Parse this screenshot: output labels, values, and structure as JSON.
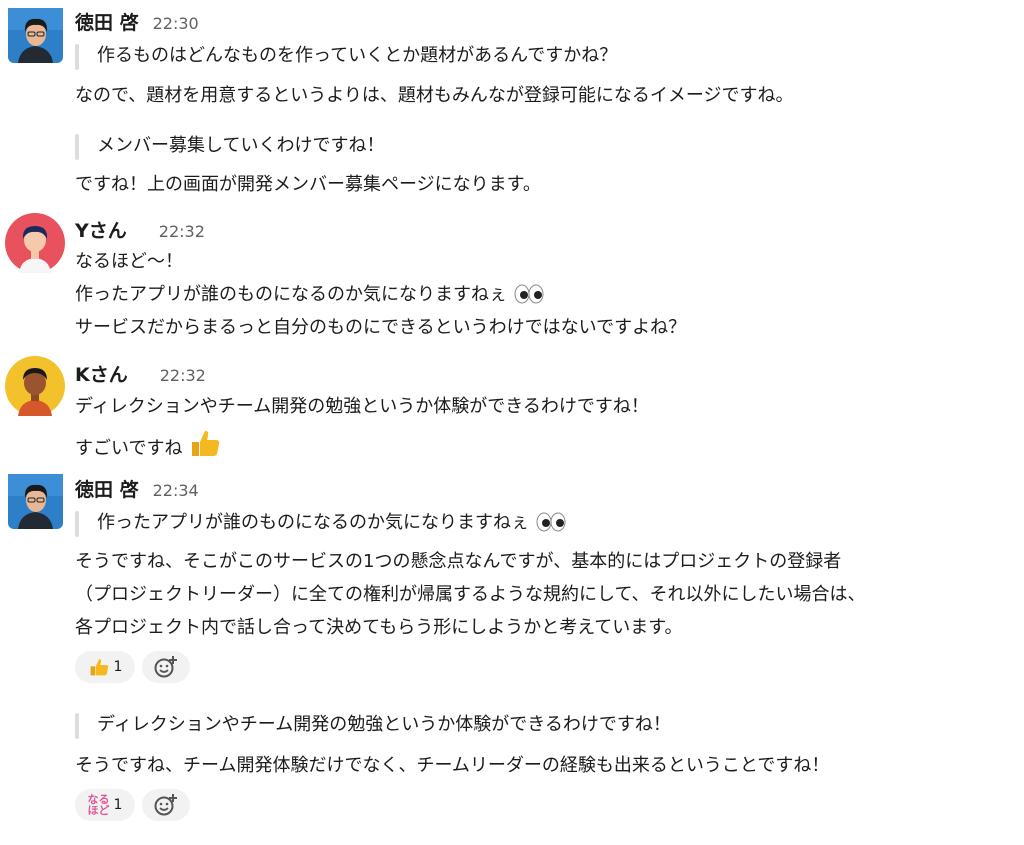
{
  "messages": [
    {
      "author": "徳田 啓",
      "time": "22:30",
      "quote1": "作るものはどんなものを作っていくとか題材があるんですかね？",
      "line1": "なので、題材を用意するというよりは、題材もみんなが登録可能になるイメージですね。",
      "quote2": "メンバー募集していくわけですね！",
      "line2": "ですね！上の画面が開発メンバー募集ページになります。"
    },
    {
      "author": "Yさん",
      "time": "22:32",
      "line1": "なるほど〜！",
      "line2": "作ったアプリが誰のものになるのか気になりますねぇ",
      "line3": "サービスだからまるっと自分のものにできるというわけではないですよね？"
    },
    {
      "author": "Kさん",
      "time": "22:32",
      "line1": "ディレクションやチーム開発の勉強というか体験ができるわけですね！",
      "line2": "すごいですね"
    },
    {
      "author": "徳田 啓",
      "time": "22:34",
      "quote1": "作ったアプリが誰のものになるのか気になりますねぇ",
      "line1": "そうですね、そこがこのサービスの1つの懸念点なんですが、基本的にはプロジェクトの登録者",
      "line2": "（プロジェクトリーダー）に全ての権利が帰属するような規約にして、それ以外にしたい場合は、",
      "line3": "各プロジェクト内で話し合って決めてもらう形にしようかと考えています。",
      "reaction1": {
        "icon": "thumbs-up",
        "count": "1"
      },
      "quote2": "ディレクションやチーム開発の勉強というか体験ができるわけですね！",
      "line4": "そうですね、チーム開発体験だけでなく、チームリーダーの経験も出来るということですね！",
      "reaction2": {
        "icon": "naruhodo-stamp",
        "stamp_top": "なる",
        "stamp_bottom": "ほど",
        "count": "1"
      }
    }
  ],
  "colors": {
    "text": "#1d1c1d",
    "time": "#616061",
    "quote_bar": "#dddddd",
    "reaction_bg": "#f2f2f3",
    "stamp": "#e2559a"
  }
}
